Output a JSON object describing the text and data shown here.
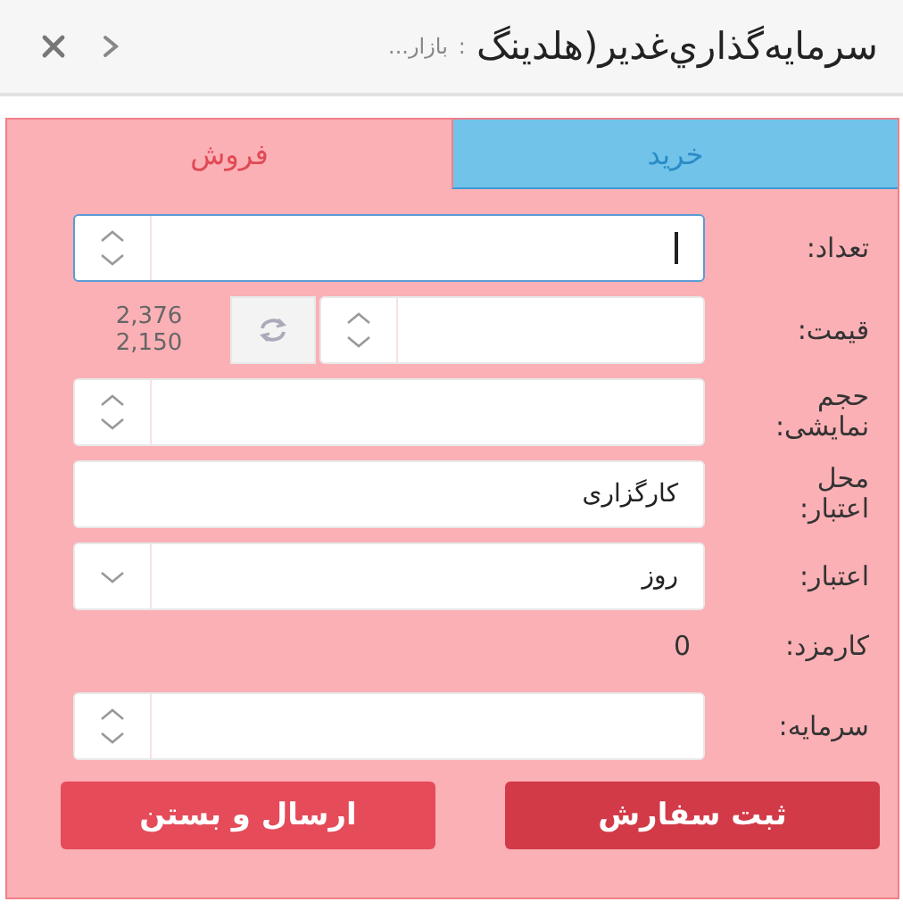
{
  "header": {
    "title": "سرمايه‌گذاري‌غدير(هلدينگ",
    "separator": ":",
    "subtitle": "بازار..."
  },
  "tabs": [
    {
      "label": "خرید",
      "selected": false
    },
    {
      "label": "فروش",
      "selected": true
    }
  ],
  "fields": [
    {
      "kind": "spinner",
      "label": "تعداد:",
      "focused": true
    },
    {
      "kind": "price",
      "label": "قیمت:",
      "prices": [
        "2,376",
        "2,150"
      ]
    },
    {
      "kind": "spinner",
      "label": "حجم نمایشی:",
      "focused": false
    },
    {
      "kind": "text",
      "label": "محل اعتبار:",
      "value": "کارگزاری"
    },
    {
      "kind": "select",
      "label": "اعتبار:",
      "value": "روز"
    },
    {
      "kind": "readout",
      "label": "کارمزد:",
      "value": "0"
    },
    {
      "kind": "spinner",
      "label": "سرمایه:",
      "focused": false
    }
  ],
  "buttons": [
    {
      "label": "ثبت سفارش",
      "kind": "primary"
    },
    {
      "label": "ارسال و بستن",
      "kind": "secondary"
    }
  ]
}
